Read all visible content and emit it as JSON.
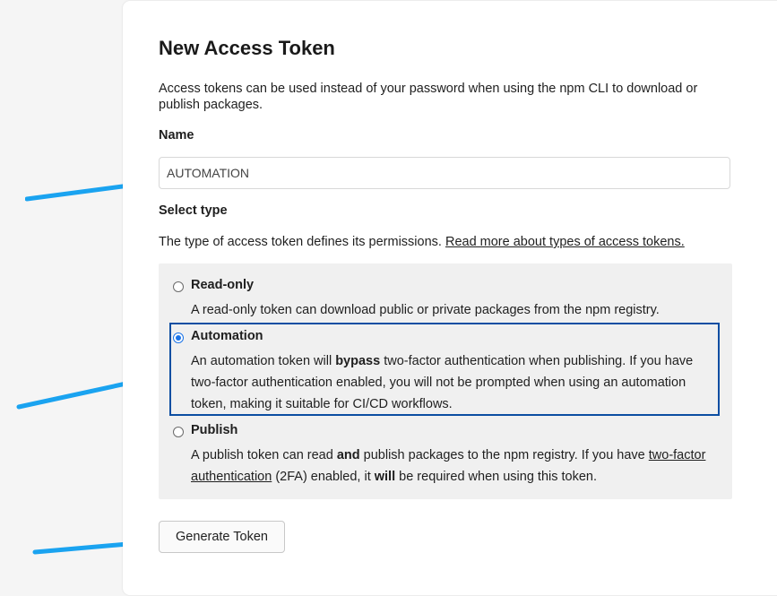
{
  "form": {
    "title": "New Access Token",
    "intro": "Access tokens can be used instead of your password when using the npm CLI to download or publish packages.",
    "name_label": "Name",
    "name_value": "AUTOMATION",
    "type_label": "Select type",
    "type_description": "The type of access token defines its permissions. ",
    "type_link": "Read more about types of access tokens."
  },
  "options": {
    "readonly": {
      "title": "Read-only",
      "desc": "A read-only token can download public or private packages from the npm registry."
    },
    "automation": {
      "title": "Automation",
      "desc_pre": "An automation token will ",
      "desc_bold": "bypass",
      "desc_post": " two-factor authentication when publishing. If you have two-factor authentication enabled, you will not be prompted when using an automation token, making it suitable for CI/CD workflows.",
      "selected": true
    },
    "publish": {
      "title": "Publish",
      "desc_pre": "A publish token can read ",
      "desc_bold1": "and",
      "desc_mid": " publish packages to the npm registry. If you have ",
      "desc_link": "two-factor authentication",
      "desc_mid2": " (2FA) enabled, it ",
      "desc_bold2": "will",
      "desc_post": " be required when using this token."
    }
  },
  "actions": {
    "generate_label": "Generate Token"
  },
  "colors": {
    "arrow": "#1aa3f0",
    "selection_border": "#0b4ea2"
  }
}
